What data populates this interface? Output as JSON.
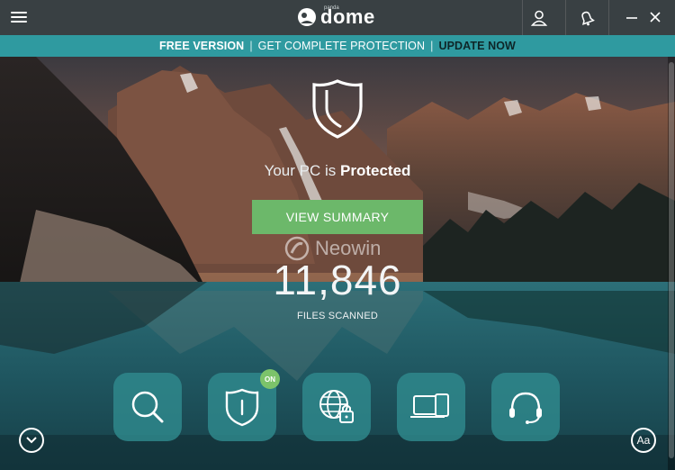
{
  "app": {
    "logo_small": "panda",
    "logo_text": "dome"
  },
  "titlebar": {
    "icons": [
      "menu-icon",
      "user-icon",
      "bell-icon",
      "minimize-icon",
      "close-icon"
    ]
  },
  "banner": {
    "free_version": "FREE VERSION",
    "separator": "|",
    "get_protection": "GET COMPLETE PROTECTION",
    "update_now": "UPDATE NOW"
  },
  "status": {
    "prefix": "Your PC is ",
    "state": "Protected"
  },
  "summary_button": "VIEW SUMMARY",
  "watermark": "Neowin",
  "scan": {
    "count": "11,846",
    "label": "FILES SCANNED"
  },
  "tiles": [
    {
      "icon": "search-icon"
    },
    {
      "icon": "antivirus-shield-icon",
      "badge": "ON"
    },
    {
      "icon": "web-lock-icon"
    },
    {
      "icon": "devices-icon"
    },
    {
      "icon": "headset-icon"
    }
  ],
  "bottom": {
    "font_button": "Aa"
  },
  "colors": {
    "titlebar": "#394043",
    "banner": "#2f9aa0",
    "summary_button": "#6cb86a",
    "tile": "#308a8e",
    "on_badge": "#7cc36a"
  }
}
